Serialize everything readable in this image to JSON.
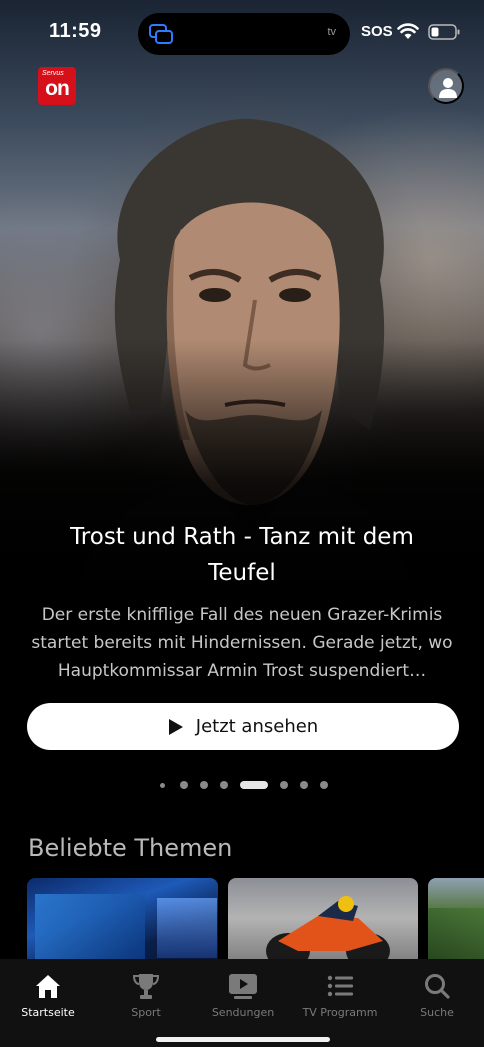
{
  "status_bar": {
    "time": "11:59",
    "island_app_label": "tv",
    "sos": "SOS"
  },
  "brand": {
    "logo_small": "Servus",
    "logo_main": "on",
    "accent_color": "#d5101a"
  },
  "hero": {
    "title": "Trost und Rath - Tanz mit dem Teufel",
    "description": "Der erste knifflige Fall des neuen Grazer-Krimis startet bereits mit Hindernissen. Gerade jetzt, wo Hauptkommissar Armin Trost suspendiert…",
    "watch_button": "Jetzt ansehen",
    "pagination": {
      "total": 8,
      "active_index": 4
    }
  },
  "sections": [
    {
      "title": "Beliebte Themen",
      "tiles": [
        {
          "icon": "news-studio-image"
        },
        {
          "icon": "motorbike-racing-image"
        },
        {
          "icon": "mountain-landscape-image"
        }
      ]
    }
  ],
  "tabbar": {
    "active": "home",
    "items": [
      {
        "id": "home",
        "label": "Startseite",
        "icon": "home-icon"
      },
      {
        "id": "sport",
        "label": "Sport",
        "icon": "trophy-icon"
      },
      {
        "id": "shows",
        "label": "Sendungen",
        "icon": "play-screen-icon"
      },
      {
        "id": "tvguide",
        "label": "TV Programm",
        "icon": "list-icon"
      },
      {
        "id": "search",
        "label": "Suche",
        "icon": "search-icon"
      }
    ]
  }
}
